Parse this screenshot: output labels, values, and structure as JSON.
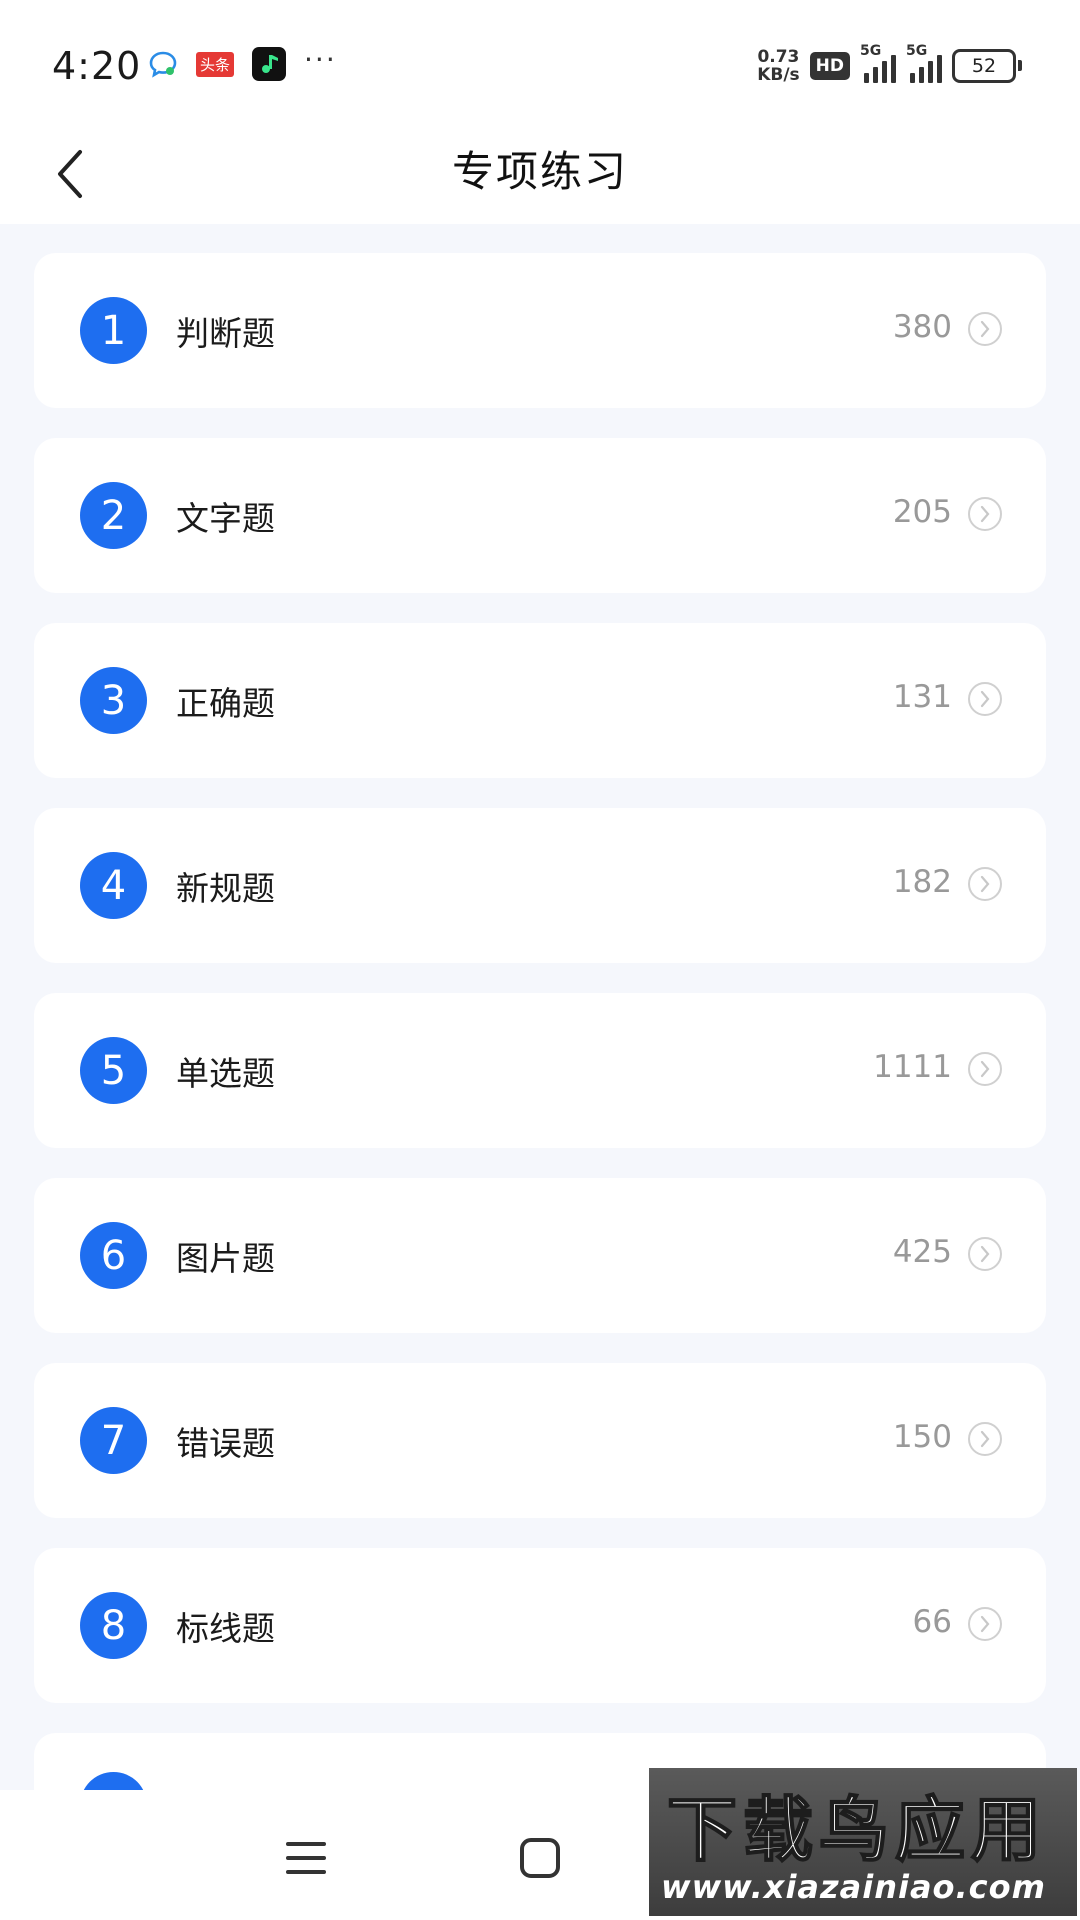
{
  "status_bar": {
    "time": "4:20",
    "toutiao_label": "头条",
    "more": "···",
    "net_speed_value": "0.73",
    "net_speed_unit": "KB/s",
    "hd_label": "HD",
    "signal1_label": "5G",
    "signal2_label": "5G",
    "battery_level": "52"
  },
  "header": {
    "title": "专项练习",
    "back_icon": "chevron-left-icon"
  },
  "practice_items": [
    {
      "number": "1",
      "label": "判断题",
      "count": "380"
    },
    {
      "number": "2",
      "label": "文字题",
      "count": "205"
    },
    {
      "number": "3",
      "label": "正确题",
      "count": "131"
    },
    {
      "number": "4",
      "label": "新规题",
      "count": "182"
    },
    {
      "number": "5",
      "label": "单选题",
      "count": "1111"
    },
    {
      "number": "6",
      "label": "图片题",
      "count": "425"
    },
    {
      "number": "7",
      "label": "错误题",
      "count": "150"
    },
    {
      "number": "8",
      "label": "标线题",
      "count": "66"
    }
  ],
  "nav_bar": {
    "menu_icon": "menu-icon",
    "home_icon": "square-home-icon"
  },
  "watermark": {
    "title": "下载鸟应用",
    "url": "www.xiazainiao.com"
  },
  "colors": {
    "accent": "#1E6EF0",
    "background": "#F5F7FC",
    "card": "#FFFFFF",
    "count_text": "#999999"
  }
}
